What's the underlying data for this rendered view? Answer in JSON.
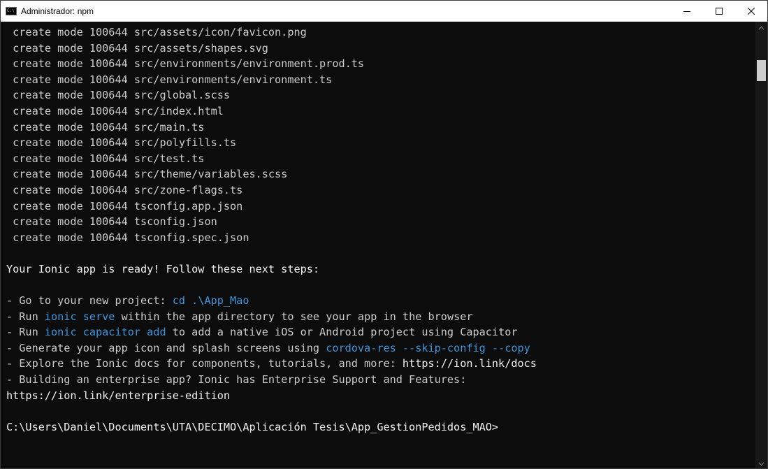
{
  "window": {
    "title": "Administrador: npm",
    "icon": "cmd-console-icon",
    "icon_text": "C:\\"
  },
  "controls": {
    "minimize_icon": "minimize-icon",
    "maximize_icon": "maximize-icon",
    "close_icon": "close-icon"
  },
  "terminal": {
    "lines": [
      [
        {
          "t": " create mode 100644 src/assets/icon/favicon.png",
          "c": ""
        }
      ],
      [
        {
          "t": " create mode 100644 src/assets/shapes.svg",
          "c": ""
        }
      ],
      [
        {
          "t": " create mode 100644 src/environments/environment.prod.ts",
          "c": ""
        }
      ],
      [
        {
          "t": " create mode 100644 src/environments/environment.ts",
          "c": ""
        }
      ],
      [
        {
          "t": " create mode 100644 src/global.scss",
          "c": ""
        }
      ],
      [
        {
          "t": " create mode 100644 src/index.html",
          "c": ""
        }
      ],
      [
        {
          "t": " create mode 100644 src/main.ts",
          "c": ""
        }
      ],
      [
        {
          "t": " create mode 100644 src/polyfills.ts",
          "c": ""
        }
      ],
      [
        {
          "t": " create mode 100644 src/test.ts",
          "c": ""
        }
      ],
      [
        {
          "t": " create mode 100644 src/theme/variables.scss",
          "c": ""
        }
      ],
      [
        {
          "t": " create mode 100644 src/zone-flags.ts",
          "c": ""
        }
      ],
      [
        {
          "t": " create mode 100644 tsconfig.app.json",
          "c": ""
        }
      ],
      [
        {
          "t": " create mode 100644 tsconfig.json",
          "c": ""
        }
      ],
      [
        {
          "t": " create mode 100644 tsconfig.spec.json",
          "c": ""
        }
      ],
      [
        {
          "t": "",
          "c": ""
        }
      ],
      [
        {
          "t": "Your Ionic app is ready! Follow these next steps:",
          "c": "wt"
        }
      ],
      [
        {
          "t": "",
          "c": ""
        }
      ],
      [
        {
          "t": "- Go to your new project: ",
          "c": ""
        },
        {
          "t": "cd .\\App_Mao",
          "c": "hl"
        }
      ],
      [
        {
          "t": "- Run ",
          "c": ""
        },
        {
          "t": "ionic serve",
          "c": "hl"
        },
        {
          "t": " within the app directory to see your app in the browser",
          "c": ""
        }
      ],
      [
        {
          "t": "- Run ",
          "c": ""
        },
        {
          "t": "ionic capacitor add",
          "c": "hl"
        },
        {
          "t": " to add a native iOS or Android project using Capacitor",
          "c": ""
        }
      ],
      [
        {
          "t": "- Generate your app icon and splash screens using ",
          "c": ""
        },
        {
          "t": "cordova-res --skip-config --copy",
          "c": "hl"
        }
      ],
      [
        {
          "t": "- Explore the Ionic docs for components, tutorials, and more: ",
          "c": ""
        },
        {
          "t": "https://ion.link/docs",
          "c": "wt"
        }
      ],
      [
        {
          "t": "- Building an enterprise app? Ionic has Enterprise Support and Features:",
          "c": ""
        }
      ],
      [
        {
          "t": "https://ion.link/enterprise-edition",
          "c": "wt"
        }
      ],
      [
        {
          "t": "",
          "c": ""
        }
      ],
      [
        {
          "t": "C:\\Users\\Daniel\\Documents\\UTA\\DECIMO\\Aplicación Tesis\\App_GestionPedidos_MAO>",
          "c": "wt"
        }
      ]
    ]
  },
  "scrollbar": {
    "up_icon": "scroll-up-arrow-icon",
    "down_icon": "scroll-down-arrow-icon"
  },
  "colors": {
    "background": "#0c0c0c",
    "text": "#cccccc",
    "highlight": "#3a96dd",
    "bright_text": "#f2f2f2",
    "titlebar": "#ffffff"
  }
}
